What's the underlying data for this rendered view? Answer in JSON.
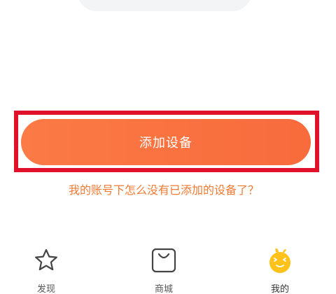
{
  "main": {
    "add_device_label": "添加设备",
    "help_link": "我的账号下怎么没有已添加的设备了？"
  },
  "bottom_nav": {
    "items": [
      {
        "label": "发现",
        "icon": "star-icon"
      },
      {
        "label": "商城",
        "icon": "shopping-bag-icon"
      },
      {
        "label": "我的",
        "icon": "mascot-face-icon"
      }
    ]
  },
  "colors": {
    "button_start": "#fb7a45",
    "button_end": "#f86b3c",
    "link": "#f07a32",
    "highlight": "#e0112b",
    "mascot": "#ffc21a"
  }
}
